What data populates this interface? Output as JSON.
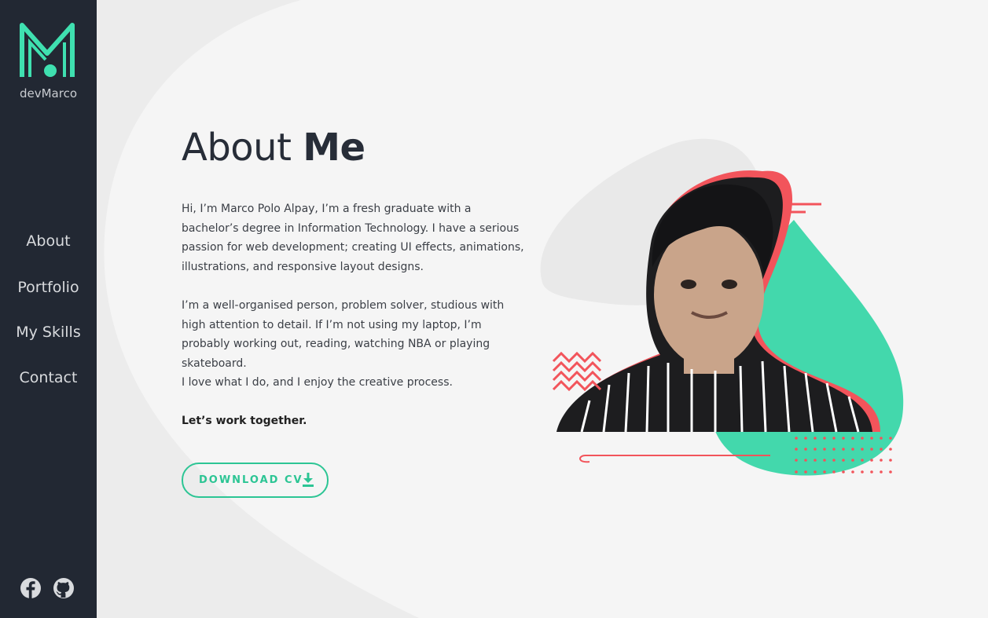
{
  "sidebar": {
    "logo_text": "devMarco",
    "nav": [
      {
        "label": "About"
      },
      {
        "label": "Portfolio"
      },
      {
        "label": "My Skills"
      },
      {
        "label": "Contact"
      }
    ],
    "social": [
      "facebook-icon",
      "github-icon"
    ]
  },
  "main": {
    "title_light": "About",
    "title_bold": "Me",
    "paragraphs": [
      "Hi, I’m Marco Polo Alpay, I’m a fresh graduate with a bachelor’s degree in Information Technology. I have a serious passion for web development; creating UI effects, animations, illustrations, and responsive layout designs.",
      "I’m a well-organised person, problem solver, studious with high attention to detail. If I’m not using my laptop, I’m probably working out, reading, watching NBA or playing skateboard.",
      "I love what I do, and I enjoy the creative process."
    ],
    "cta": "Let’s work together.",
    "download_label": "DOWNLOAD CV"
  },
  "colors": {
    "sidebar_bg": "#222833",
    "accent": "#2cc594",
    "coral": "#f2545b",
    "page_bg": "#f5f5f5"
  }
}
